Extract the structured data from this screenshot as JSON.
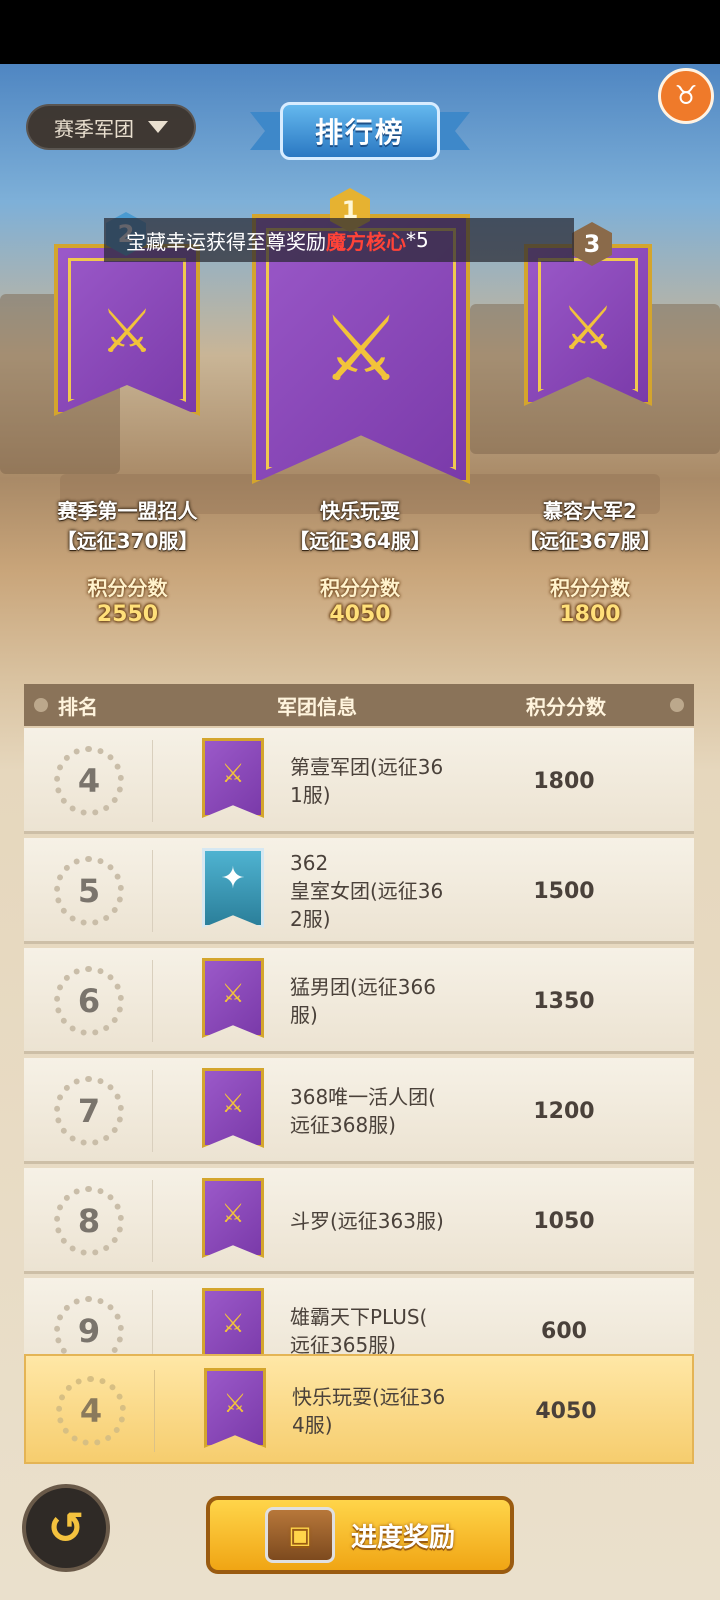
{
  "header": {
    "dropdown_label": "赛季军团",
    "title": "排行榜"
  },
  "notice": {
    "prefix": "宝藏幸运获得至尊奖励",
    "highlight": "魔方核心",
    "suffix": "*5"
  },
  "podium": [
    {
      "rank": "1",
      "name": "快乐玩耍",
      "server": "【远征364服】",
      "score_label": "积分分数",
      "score": "4050"
    },
    {
      "rank": "2",
      "name": "赛季第一盟招人",
      "server": "【远征370服】",
      "score_label": "积分分数",
      "score": "2550"
    },
    {
      "rank": "3",
      "name": "慕容大军2",
      "server": "【远征367服】",
      "score_label": "积分分数",
      "score": "1800"
    }
  ],
  "table": {
    "headers": {
      "rank": "排名",
      "info": "军团信息",
      "score": "积分分数"
    },
    "rows": [
      {
        "rank": "4",
        "name": "第壹军团(远征36\n1服)",
        "score": "1800",
        "icon": "purple-swords-flag-icon"
      },
      {
        "rank": "5",
        "name": "362\n皇室女团(远征36\n2服)",
        "score": "1500",
        "icon": "eagle-flag-icon"
      },
      {
        "rank": "6",
        "name": "猛男团(远征366\n服)",
        "score": "1350",
        "icon": "purple-swords-flag-icon"
      },
      {
        "rank": "7",
        "name": "368唯一活人团(\n远征368服)",
        "score": "1200",
        "icon": "purple-swords-flag-icon"
      },
      {
        "rank": "8",
        "name": "斗罗(远征363服)",
        "score": "1050",
        "icon": "purple-swords-flag-icon"
      },
      {
        "rank": "9",
        "name": "雄霸天下PLUS(\n远征365服)",
        "score": "600",
        "icon": "purple-swords-flag-icon"
      }
    ]
  },
  "my_row": {
    "rank": "4",
    "name": "快乐玩耍(远征36\n4服)",
    "score": "4050"
  },
  "bottom": {
    "reward_button": "进度奖励"
  },
  "colors": {
    "accent_gold": "#f0a514",
    "banner_purple": "#8a49b9",
    "highlight_red": "#ff4338"
  }
}
